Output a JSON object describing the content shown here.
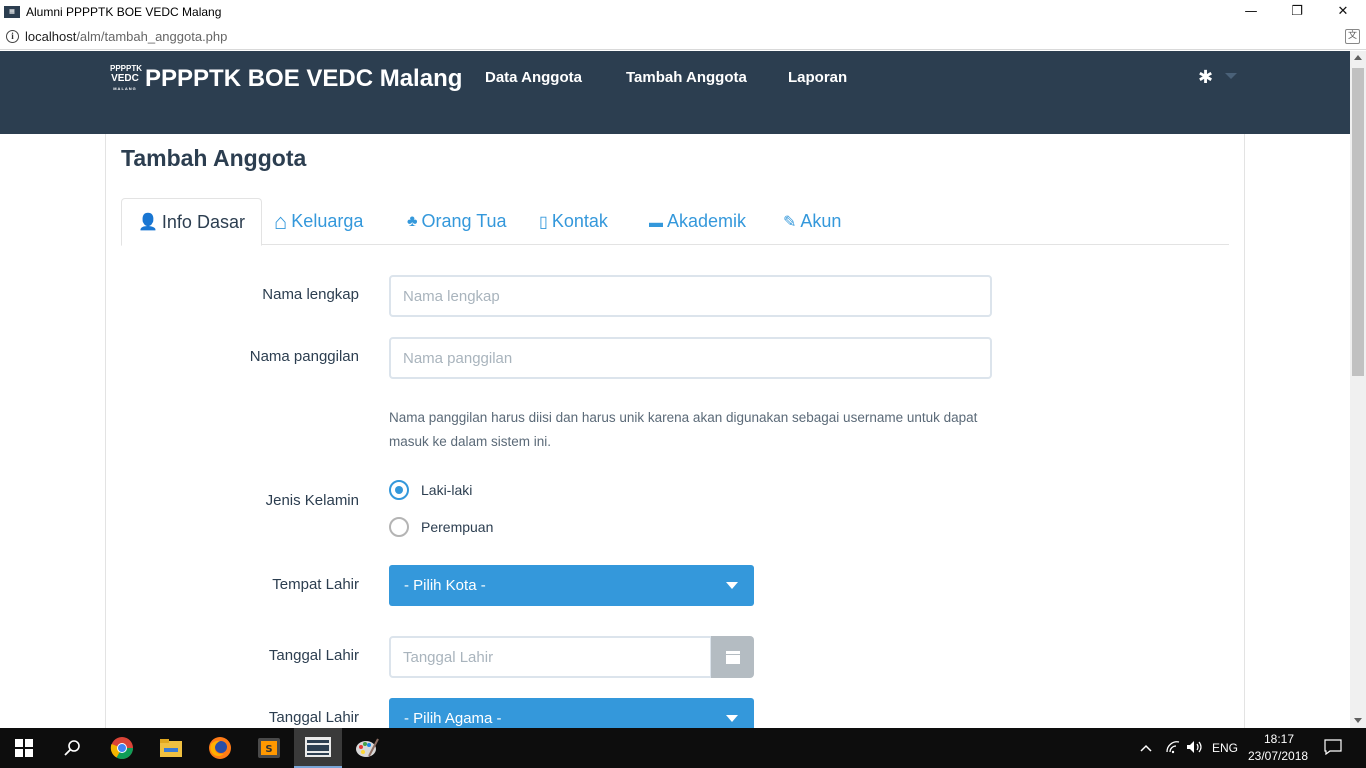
{
  "window": {
    "title": "Alumni PPPPTK BOE VEDC Malang",
    "minimize": "—",
    "restore": "❐",
    "close": "✕"
  },
  "address": {
    "host": "localhost",
    "path": "/alm/tambah_anggota.php"
  },
  "navbar": {
    "logo_line1": "PPPPTK",
    "logo_line2": "VEDC",
    "logo_line3": "MALANG",
    "brand": "PPPPTK BOE VEDC Malang",
    "links": [
      "Data Anggota",
      "Tambah Anggota",
      "Laporan"
    ],
    "settings_glyph": "✱"
  },
  "page": {
    "title": "Tambah Anggota"
  },
  "tabs": [
    {
      "label": "Info Dasar",
      "icon": "user-icon",
      "glyph": "👤"
    },
    {
      "label": "Keluarga",
      "icon": "home-icon",
      "glyph": "⌂"
    },
    {
      "label": "Orang Tua",
      "icon": "tree-icon",
      "glyph": "♣"
    },
    {
      "label": "Kontak",
      "icon": "mobile-icon",
      "glyph": "▯"
    },
    {
      "label": "Akademik",
      "icon": "briefcase-icon",
      "glyph": "▬"
    },
    {
      "label": "Akun",
      "icon": "wrench-icon",
      "glyph": "✎"
    }
  ],
  "form": {
    "nama_lengkap": {
      "label": "Nama lengkap",
      "placeholder": "Nama lengkap",
      "value": ""
    },
    "nama_panggilan": {
      "label": "Nama panggilan",
      "placeholder": "Nama panggilan",
      "value": ""
    },
    "help_text": "Nama panggilan harus diisi dan harus unik karena akan digunakan sebagai username untuk dapat masuk ke dalam sistem ini.",
    "jenis_kelamin": {
      "label": "Jenis Kelamin",
      "options": [
        "Laki-laki",
        "Perempuan"
      ],
      "selected": "Laki-laki"
    },
    "tempat_lahir": {
      "label": "Tempat Lahir",
      "selected": "- Pilih Kota -"
    },
    "tanggal_lahir": {
      "label": "Tanggal Lahir",
      "placeholder": "Tanggal Lahir",
      "value": ""
    },
    "agama": {
      "label": "Tanggal Lahir",
      "selected": "- Pilih Agama -"
    }
  },
  "taskbar": {
    "language": "ENG",
    "time": "18:17",
    "date": "23/07/2018"
  },
  "colors": {
    "navbar": "#2c3e50",
    "primary": "#3498db",
    "text": "#2c3e50"
  }
}
